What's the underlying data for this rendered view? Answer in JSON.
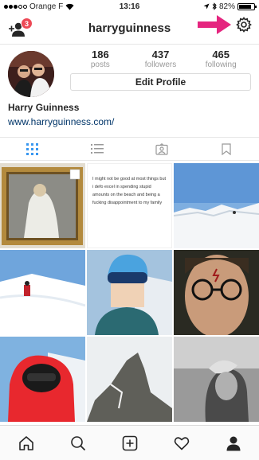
{
  "status_bar": {
    "carrier": "Orange F",
    "time": "13:16",
    "battery": "82%",
    "battery_level": 0.82
  },
  "header": {
    "username": "harryguinness",
    "notification_count": "3"
  },
  "profile": {
    "name": "Harry Guinness",
    "website": "www.harryguinness.com/",
    "edit_button_label": "Edit Profile",
    "stats": [
      {
        "value": "186",
        "label": "posts"
      },
      {
        "value": "437",
        "label": "followers"
      },
      {
        "value": "465",
        "label": "following"
      }
    ]
  },
  "tabs": [
    {
      "icon": "grid-icon",
      "active": true
    },
    {
      "icon": "list-icon",
      "active": false
    },
    {
      "icon": "tagged-photos-icon",
      "active": false
    },
    {
      "icon": "bookmark-icon",
      "active": false
    }
  ],
  "posts": {
    "text_post": "I might not be good at most things but i defo excel in spending stupid amounts on the beach and being a fucking disappointment to my family"
  },
  "bottom_nav": [
    {
      "icon": "home-icon"
    },
    {
      "icon": "search-icon"
    },
    {
      "icon": "new-post-icon"
    },
    {
      "icon": "activity-heart-icon"
    },
    {
      "icon": "profile-icon"
    }
  ],
  "colors": {
    "accent_arrow": "#e5257f",
    "link": "#003569",
    "badge": "#ed4956",
    "active_tab": "#3897f0"
  }
}
